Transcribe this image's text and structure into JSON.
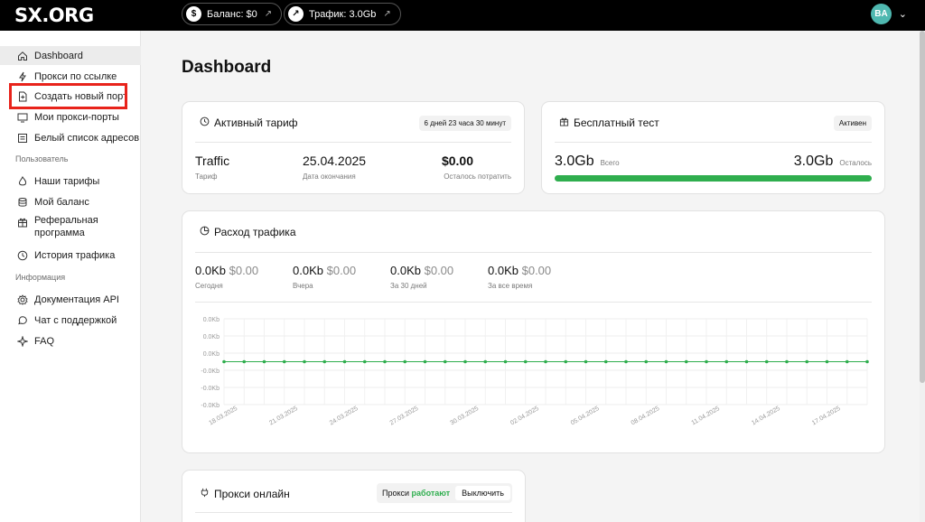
{
  "header": {
    "logo": "SX.ORG",
    "balance_label": "Баланс: $0",
    "traffic_label": "Трафик: 3.0Gb",
    "avatar_initials": "BA"
  },
  "sidebar": {
    "items": [
      {
        "label": "Dashboard",
        "icon": "home-icon",
        "active": true
      },
      {
        "label": "Прокси по ссылке",
        "icon": "bolt-icon"
      },
      {
        "label": "Создать новый порт",
        "icon": "file-plus-icon"
      },
      {
        "label": "Мои прокси-порты",
        "icon": "monitor-icon"
      },
      {
        "label": "Белый список адресов",
        "icon": "list-icon"
      }
    ],
    "section_user": "Пользователь",
    "user_items": [
      {
        "label": "Наши тарифы",
        "icon": "flame-icon"
      },
      {
        "label": "Мой баланс",
        "icon": "coins-icon"
      },
      {
        "label": "Реферальная программа",
        "line1": "Реферальная",
        "line2": "программа",
        "icon": "gift-icon"
      },
      {
        "label": "История трафика",
        "icon": "clock-icon"
      }
    ],
    "section_info": "Информация",
    "info_items": [
      {
        "label": "Документация API",
        "icon": "gear-icon"
      },
      {
        "label": "Чат с поддержкой",
        "icon": "chat-icon"
      },
      {
        "label": "FAQ",
        "icon": "sparkle-icon"
      }
    ]
  },
  "main": {
    "title": "Dashboard",
    "tariff_card": {
      "title": "Активный тариф",
      "badge": "6 дней 23 часа 30 минут",
      "plan_value": "Traffic",
      "plan_label": "Тариф",
      "end_value": "25.04.2025",
      "end_label": "Дата окончания",
      "left_value": "$0.00",
      "left_label": "Осталось потратить"
    },
    "trial_card": {
      "title": "Бесплатный тест",
      "badge": "Активен",
      "total_value": "3.0Gb",
      "total_label": "Всего",
      "left_value": "3.0Gb",
      "left_label": "Осталось",
      "progress": 1.0
    },
    "usage_card": {
      "title": "Расход трафика",
      "stats": [
        {
          "value": "0.0Kb",
          "money": "$0.00",
          "label": "Сегодня"
        },
        {
          "value": "0.0Kb",
          "money": "$0.00",
          "label": "Вчера"
        },
        {
          "value": "0.0Kb",
          "money": "$0.00",
          "label": "За 30 дней"
        },
        {
          "value": "0.0Kb",
          "money": "$0.00",
          "label": "За все время"
        }
      ]
    },
    "proxy_card": {
      "title": "Прокси онлайн",
      "status_prefix": "Прокси",
      "status_value": "работают",
      "off_button": "Выключить"
    }
  },
  "chart_data": {
    "type": "line",
    "y_tick_labels": [
      "0.0Kb",
      "0.0Kb",
      "0.0Kb",
      "-0.0Kb",
      "-0.0Kb",
      "-0.0Kb"
    ],
    "x_tick_labels": [
      "18.03.2025",
      "21.03.2025",
      "24.03.2025",
      "27.03.2025",
      "30.03.2025",
      "02.04.2025",
      "05.04.2025",
      "08.04.2025",
      "11.04.2025",
      "14.04.2025",
      "17.04.2025"
    ],
    "x_start": "18.03.2025",
    "x_end": "18.04.2025",
    "point_count": 33,
    "series": [
      {
        "color": "#2fae4e",
        "values_constant": 0
      }
    ],
    "grid": true
  },
  "colors": {
    "accent": "#2fae4e",
    "highlight": "#e8231b",
    "avatar": "#4fb8b0"
  }
}
